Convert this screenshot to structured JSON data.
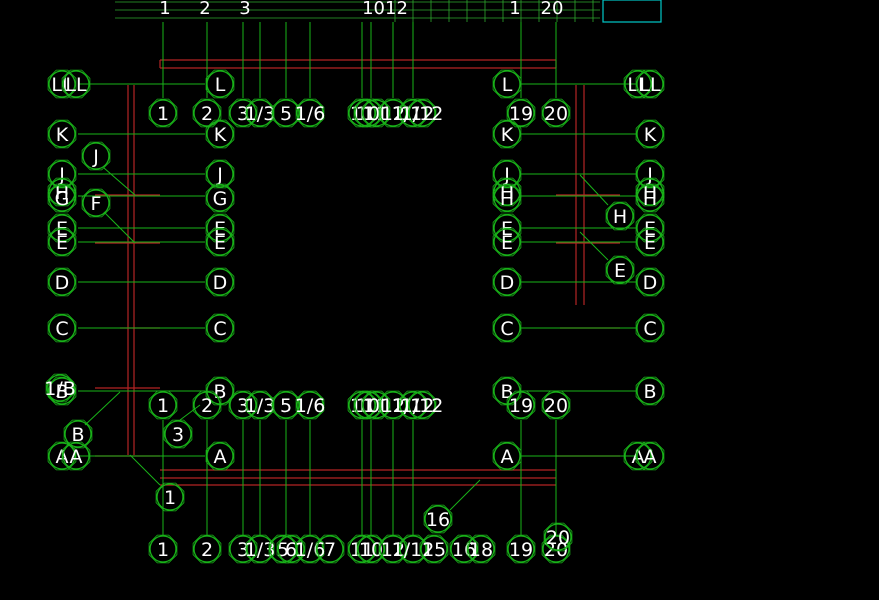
{
  "colors": {
    "background": "#000000",
    "bubble": "#19b319",
    "beam": "#b32424",
    "text": "#ffffff",
    "title_block": "#00c8c8"
  },
  "top_strip": {
    "label_1": "1",
    "label_2": "2",
    "label_3": "3",
    "label_4": "1012",
    "label_5": "1",
    "label_6": "20"
  },
  "grid_bubbles": {
    "row_letters": [
      "LL",
      "L",
      "K",
      "J",
      "H",
      "G",
      "F",
      "E",
      "D",
      "C",
      "B",
      "A"
    ],
    "col_numbers": [
      "1",
      "2",
      "3",
      "1/3",
      "5",
      "1/6",
      "11",
      "10",
      "12",
      "1/12",
      "19",
      "20"
    ],
    "bottom_numbers": [
      "1",
      "2",
      "3",
      "1/3",
      "5",
      "6",
      "1/6",
      "7",
      "11",
      "10",
      "12",
      "1/12",
      "15",
      "16",
      "18",
      "19",
      "20"
    ],
    "extra": [
      "1/B",
      "1",
      "3",
      "16",
      "20"
    ]
  }
}
